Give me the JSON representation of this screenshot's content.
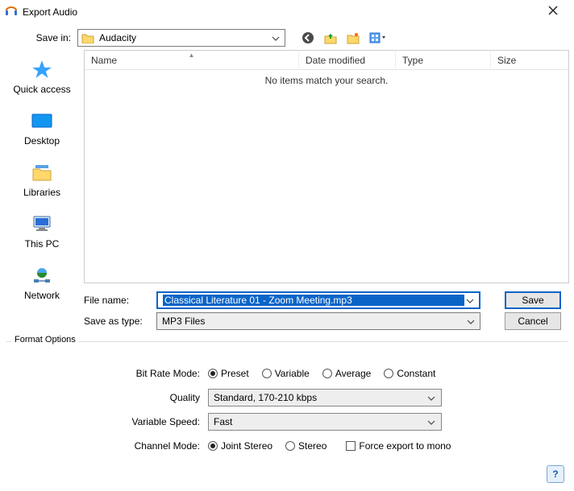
{
  "window": {
    "title": "Export Audio"
  },
  "save_in": {
    "label": "Save in:",
    "value": "Audacity"
  },
  "places": [
    {
      "key": "quick-access",
      "label": "Quick access"
    },
    {
      "key": "desktop",
      "label": "Desktop"
    },
    {
      "key": "libraries",
      "label": "Libraries"
    },
    {
      "key": "this-pc",
      "label": "This PC"
    },
    {
      "key": "network",
      "label": "Network"
    }
  ],
  "columns": {
    "name": "Name",
    "date": "Date modified",
    "type": "Type",
    "size": "Size"
  },
  "listing": {
    "empty_msg": "No items match your search."
  },
  "filename": {
    "label": "File name:",
    "value": "Classical Literature 01 - Zoom Meeting.mp3"
  },
  "save_type": {
    "label": "Save as type:",
    "value": "MP3 Files"
  },
  "buttons": {
    "save": "Save",
    "cancel": "Cancel"
  },
  "format": {
    "group_title": "Format Options",
    "bitrate": {
      "label": "Bit Rate Mode:",
      "options": [
        "Preset",
        "Variable",
        "Average",
        "Constant"
      ],
      "selected": "Preset"
    },
    "quality": {
      "label": "Quality",
      "value": "Standard, 170-210 kbps"
    },
    "speed": {
      "label": "Variable Speed:",
      "value": "Fast"
    },
    "channel": {
      "label": "Channel Mode:",
      "options": [
        "Joint Stereo",
        "Stereo"
      ],
      "selected": "Joint Stereo",
      "force_mono_label": "Force export to mono",
      "force_mono": false
    }
  },
  "help": "?"
}
